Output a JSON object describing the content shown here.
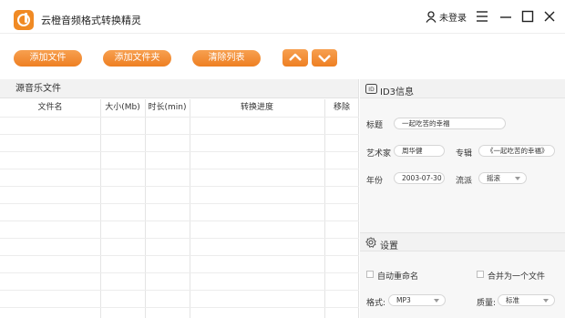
{
  "app": {
    "title": "云橙音频格式转换精灵"
  },
  "titlebar": {
    "login": "未登录"
  },
  "toolbar": {
    "add_file": "添加文件",
    "add_folder": "添加文件夹",
    "clear_list": "清除列表"
  },
  "files_panel": {
    "title": "源音乐文件",
    "columns": [
      "文件名",
      "大小(Mb)",
      "时长(min)",
      "转换进度",
      "移除"
    ]
  },
  "id3": {
    "title": "ID3信息",
    "badge": "ID",
    "title_label": "标题",
    "title_value": "一起吃苦的幸福",
    "artist_label": "艺术家",
    "artist_value": "周华健",
    "album_label": "专辑",
    "album_value": "《一起吃苦的幸福》",
    "year_label": "年份",
    "year_value": "2003-07-30",
    "genre_label": "流派",
    "genre_value": "摇滚"
  },
  "settings": {
    "title": "设置",
    "auto_rename": "自动重命名",
    "merge": "合并为一个文件",
    "format_label": "格式:",
    "format_value": "MP3",
    "quality_label": "质量:",
    "quality_value": "标准"
  },
  "colors": {
    "accent": "#ee7f22",
    "panel_bg": "#f7f7f7"
  }
}
